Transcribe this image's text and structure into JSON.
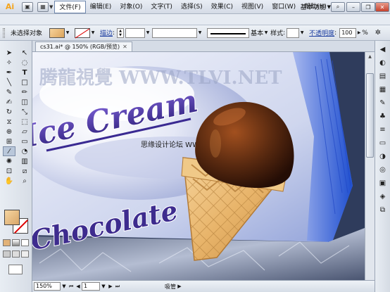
{
  "app": {
    "logo_text": "Ai",
    "menu": [
      "文件(F)",
      "编辑(E)",
      "对象(O)",
      "文字(T)",
      "选择(S)",
      "效果(C)",
      "视图(V)",
      "窗口(W)",
      "帮助(H)"
    ],
    "workspace_label": "基本功能",
    "window_buttons": [
      "search",
      "minimize",
      "restore",
      "close"
    ]
  },
  "control_bar": {
    "selection_status": "未选择对象",
    "stroke_label": "描边",
    "stroke_style_label": "基本",
    "style_label": "样式",
    "opacity_label": "不透明度",
    "opacity_value": "100",
    "opacity_unit": "%"
  },
  "document": {
    "tab_title": "cs31.ai* @ 150% (RGB/预览)",
    "artwork": {
      "watermark": "腾龍視覺 WWW.TLVI.NET",
      "headline": "Ice Cream",
      "subtitle": "Chocolate",
      "overlay_watermark": "思缘设计论坛 WWW.MISSYUAN.COM"
    }
  },
  "status_bar": {
    "zoom": "150%",
    "page": "1",
    "current_tool": "吸管"
  },
  "colors": {
    "fill": "#e2b278",
    "accent_blue": "#2a5fd0",
    "text_purple": "#3d2b8e"
  }
}
